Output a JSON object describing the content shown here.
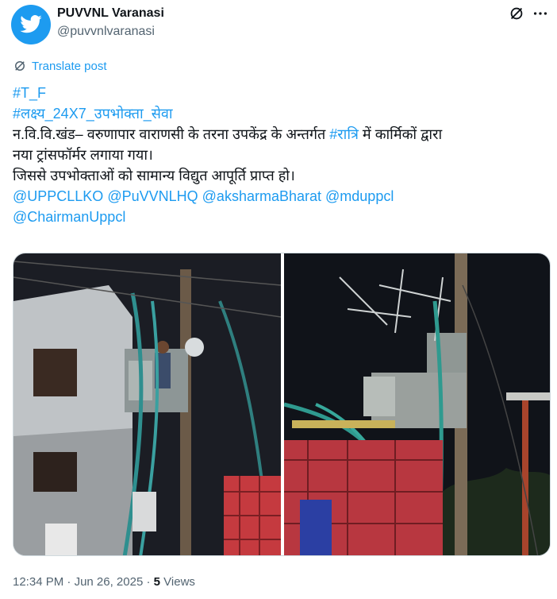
{
  "account": {
    "name": "PUVVNL Varanasi",
    "handle": "@puvvnlvaranasi"
  },
  "icons": {
    "avatar": "twitter-bird-icon",
    "grok": "slash-circle-icon",
    "more": "more-dots-icon",
    "translate": "translate-icon"
  },
  "translate_label": "Translate post",
  "post": {
    "hashtag1": "#T_F",
    "hashtag2": "#लक्ष्य_24X7_उपभोक्ता_सेवा",
    "line3_pre": "न.वि.वि.खंड– वरुणापार वाराणसी के तरना उपकेंद्र के अन्तर्गत ",
    "line3_tag": "#रात्रि",
    "line3_post": " में कार्मिकों द्वारा",
    "line4": "नया ट्रांसफॉर्मर लगाया गया।",
    "line5": "जिससे उपभोक्ताओं को सामान्य विद्युत आपूर्ति प्राप्त हो।",
    "mentions_row1": [
      "@UPPCLLKO",
      "@PuVVNLHQ",
      "@aksharmaBharat",
      "@mduppcl"
    ],
    "mentions_row2": [
      "@ChairmanUppcl"
    ]
  },
  "meta": {
    "time": "12:34 PM",
    "sep1": " · ",
    "date": "Jun 26, 2025",
    "sep2": " · ",
    "views_count": "5",
    "views_label": " Views"
  },
  "colors": {
    "link": "#1d9bf0",
    "text": "#0f1419",
    "muted": "#536471"
  }
}
